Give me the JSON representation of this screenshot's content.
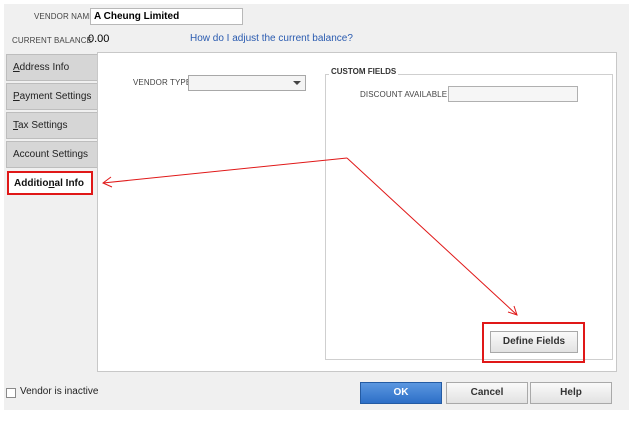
{
  "header": {
    "vendor_name_label": "VENDOR NAME",
    "vendor_name_value": "A Cheung Limited",
    "current_balance_label": "CURRENT BALANCE",
    "current_balance_value": "0.00",
    "adjust_link": "How do I adjust the current balance?"
  },
  "tabs": [
    {
      "pre": "",
      "ul": "A",
      "post": "ddress Info"
    },
    {
      "pre": "",
      "ul": "P",
      "post": "ayment Settings"
    },
    {
      "pre": "",
      "ul": "T",
      "post": "ax Settings"
    },
    {
      "pre": "Account Settin",
      "ul": "g",
      "post": "s"
    },
    {
      "pre": "Additio",
      "ul": "n",
      "post": "al Info"
    }
  ],
  "content": {
    "vendor_type_label": "VENDOR TYPE",
    "vendor_type_value": "",
    "custom_fields_title": "CUSTOM FIELDS",
    "discount_label": "DISCOUNT AVAILABLE",
    "discount_value": "",
    "define_fields_label": "Define Fields"
  },
  "footer": {
    "inactive_label": "Vendor is inactive",
    "ok_label": "OK",
    "cancel_label": "Cancel",
    "help_label": "Help"
  },
  "colors": {
    "annotation_red": "#e01818",
    "link_blue": "#2a5bb0",
    "ok_blue": "#2d6fc7"
  }
}
